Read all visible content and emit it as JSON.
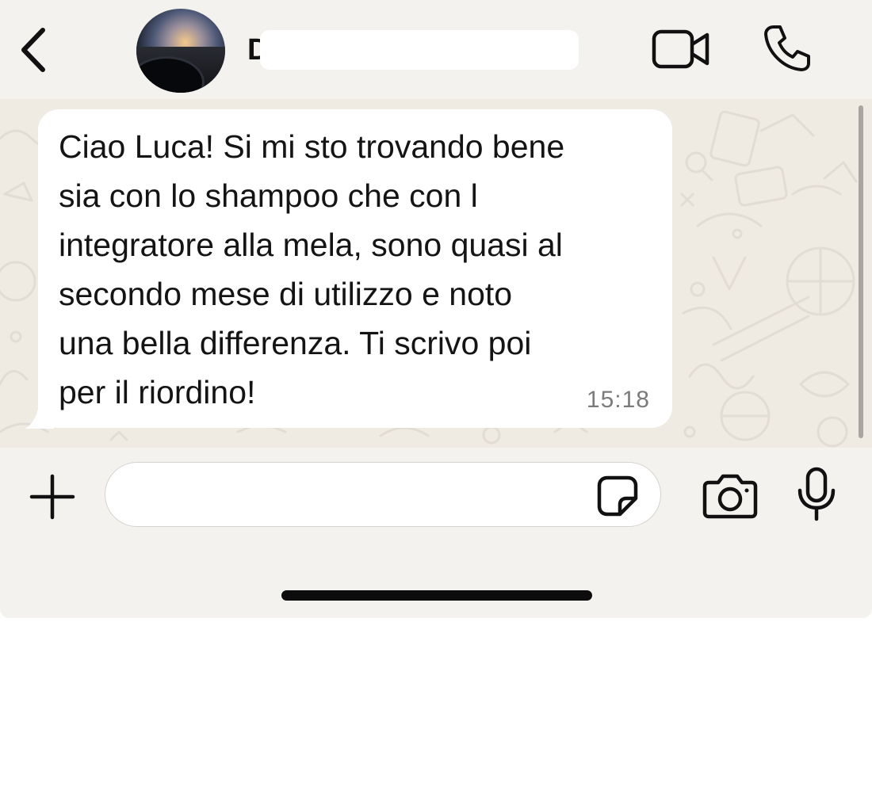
{
  "header": {
    "contact_initial": "D",
    "back_icon": "chevron-left-icon",
    "video_icon": "video-camera-icon",
    "call_icon": "phone-icon"
  },
  "chat": {
    "messages": [
      {
        "direction": "incoming",
        "text": "Ciao Luca! Si mi sto trovando bene\nsia con lo shampoo che con l\nintegratore alla mela, sono quasi al\nsecondo mese di utilizzo e noto\nuna bella differenza. Ti scrivo poi\nper il riordino!",
        "time": "15:18"
      }
    ]
  },
  "composer": {
    "input_value": "",
    "placeholder": "",
    "plus_icon": "plus-icon",
    "sticker_icon": "sticker-icon",
    "camera_icon": "camera-icon",
    "mic_icon": "microphone-icon"
  },
  "colors": {
    "chat_background": "#efeae2",
    "bubble_incoming": "#ffffff",
    "bar_background": "#f4f2ef",
    "text_primary": "#141414",
    "timestamp": "#7b7b7b"
  }
}
